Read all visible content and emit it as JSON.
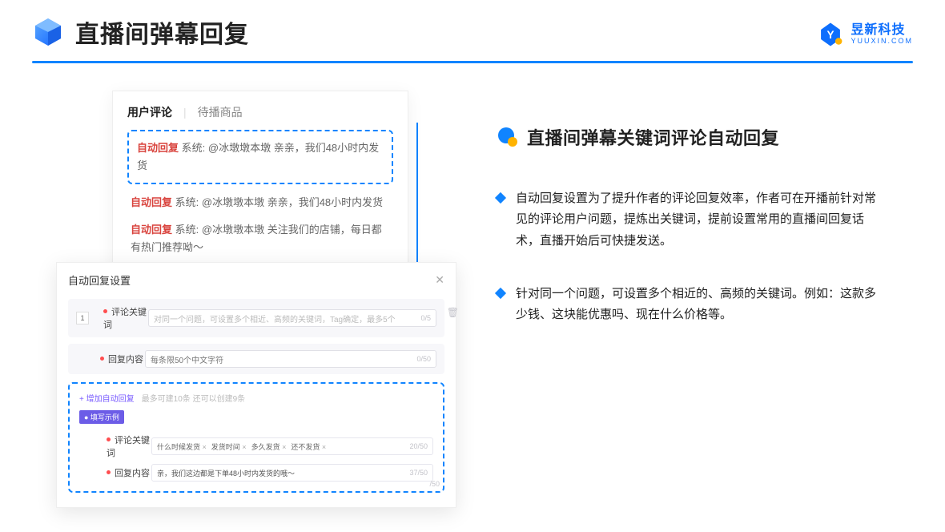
{
  "header": {
    "title": "直播间弹幕回复"
  },
  "brand": {
    "cn": "昱新科技",
    "en": "YUUXIN.COM"
  },
  "comments": {
    "tab_active": "用户评论",
    "tab_inactive": "待播商品",
    "auto_label": "自动回复",
    "sys_label": "系统:",
    "highlight": "@冰墩墩本墩 亲亲，我们48小时内发货",
    "line2": "@冰墩墩本墩 亲亲，我们48小时内发货",
    "line3": "@冰墩墩本墩 关注我们的店铺，每日都有热门推荐呦～"
  },
  "settings": {
    "title": "自动回复设置",
    "order": "1",
    "label_keyword": "评论关键词",
    "keyword_placeholder": "对同一个问题，可设置多个相近、高频的关键词，Tag确定，最多5个",
    "keyword_counter": "0/5",
    "label_content": "回复内容",
    "content_placeholder": "每条限50个中文字符",
    "content_counter": "0/50",
    "add_link": "+ 增加自动回复",
    "add_hint": "最多可建10条 还可以创建9条",
    "example_tag": "● 填写示例",
    "ex_label_keyword": "评论关键词",
    "chips": [
      "什么时候发货",
      "发货时间",
      "多久发货",
      "还不发货"
    ],
    "ex_kw_counter": "20/50",
    "ex_label_content": "回复内容",
    "ex_content_value": "亲，我们这边都是下单48小时内发货的哦～",
    "ex_content_counter": "37/50",
    "outer_counter": "/50"
  },
  "right": {
    "title": "直播间弹幕关键词评论自动回复",
    "bullet1": "自动回复设置为了提升作者的评论回复效率，作者可在开播前针对常见的评论用户问题，提炼出关键词，提前设置常用的直播间回复话术，直播开始后可快捷发送。",
    "bullet2": "针对同一个问题，可设置多个相近的、高频的关键词。例如：这款多少钱、这块能优惠吗、现在什么价格等。"
  }
}
